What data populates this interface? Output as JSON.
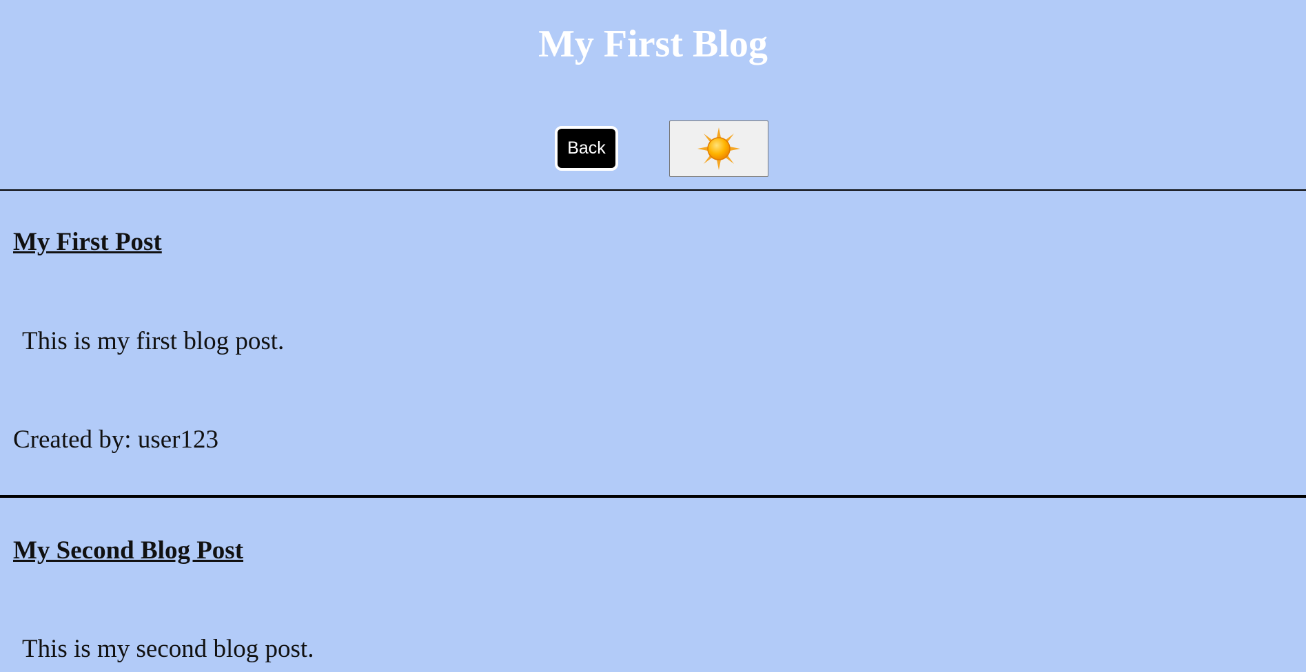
{
  "header": {
    "title": "My First Blog",
    "back_label": "Back",
    "theme_icon": "sun-icon"
  },
  "posts": [
    {
      "title": "My First Post",
      "body": "This is my first blog post.",
      "author_line": "Created by: user123"
    },
    {
      "title": "My Second Blog Post",
      "body": "This is my second blog post."
    }
  ],
  "colors": {
    "background": "#b2cbf8",
    "title_text": "#ffffff",
    "back_button_bg": "#000000"
  }
}
